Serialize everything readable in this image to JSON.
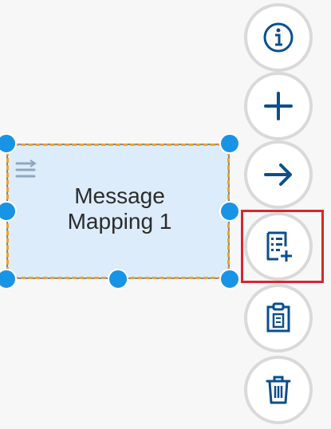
{
  "node": {
    "label_line1": "Message",
    "label_line2": "Mapping 1",
    "type_icon": "mapping-lines-icon"
  },
  "actions": [
    {
      "name": "info",
      "icon": "info-icon"
    },
    {
      "name": "add",
      "icon": "plus-icon"
    },
    {
      "name": "connect",
      "icon": "arrow-right-icon"
    },
    {
      "name": "add-step",
      "icon": "document-add-icon",
      "highlighted": true
    },
    {
      "name": "paste",
      "icon": "clipboard-icon"
    },
    {
      "name": "delete",
      "icon": "trash-icon"
    }
  ],
  "colors": {
    "icon": "#0a4f8f",
    "handle": "#1894e6",
    "selection_dash": "#f0a32a",
    "node_fill": "#dcecfb",
    "highlight": "#d9262b"
  }
}
